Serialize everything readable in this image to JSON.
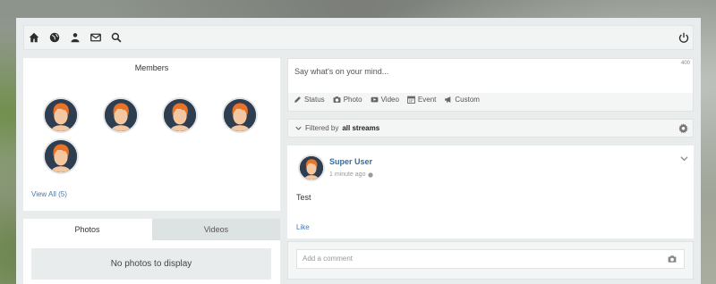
{
  "toolbar": {
    "icons": [
      "home-icon",
      "globe-icon",
      "users-icon",
      "mail-icon",
      "search-icon",
      "power-icon"
    ]
  },
  "members": {
    "title": "Members",
    "count": 5,
    "view_all_label": "View All (5)"
  },
  "media": {
    "tabs": [
      {
        "label": "Photos",
        "active": true
      },
      {
        "label": "Videos",
        "active": false
      }
    ],
    "empty_message": "No photos to display"
  },
  "composer": {
    "placeholder": "Say what's on your mind...",
    "char_limit": "400",
    "tabs": [
      {
        "label": "Status",
        "icon": "pencil-icon"
      },
      {
        "label": "Photo",
        "icon": "camera-icon"
      },
      {
        "label": "Video",
        "icon": "video-icon"
      },
      {
        "label": "Event",
        "icon": "calendar-icon"
      },
      {
        "label": "Custom",
        "icon": "megaphone-icon"
      }
    ]
  },
  "filter": {
    "prefix": "Filtered by",
    "value": "all streams"
  },
  "post": {
    "author": "Super User",
    "time": "1 minute ago",
    "body": "Test",
    "like_label": "Like"
  },
  "comment": {
    "placeholder": "Add a comment"
  },
  "colors": {
    "link": "#4a78a8",
    "author": "#2f6fa8",
    "avatar_bg": "#2e3e50",
    "avatar_hair": "#e8742a"
  }
}
